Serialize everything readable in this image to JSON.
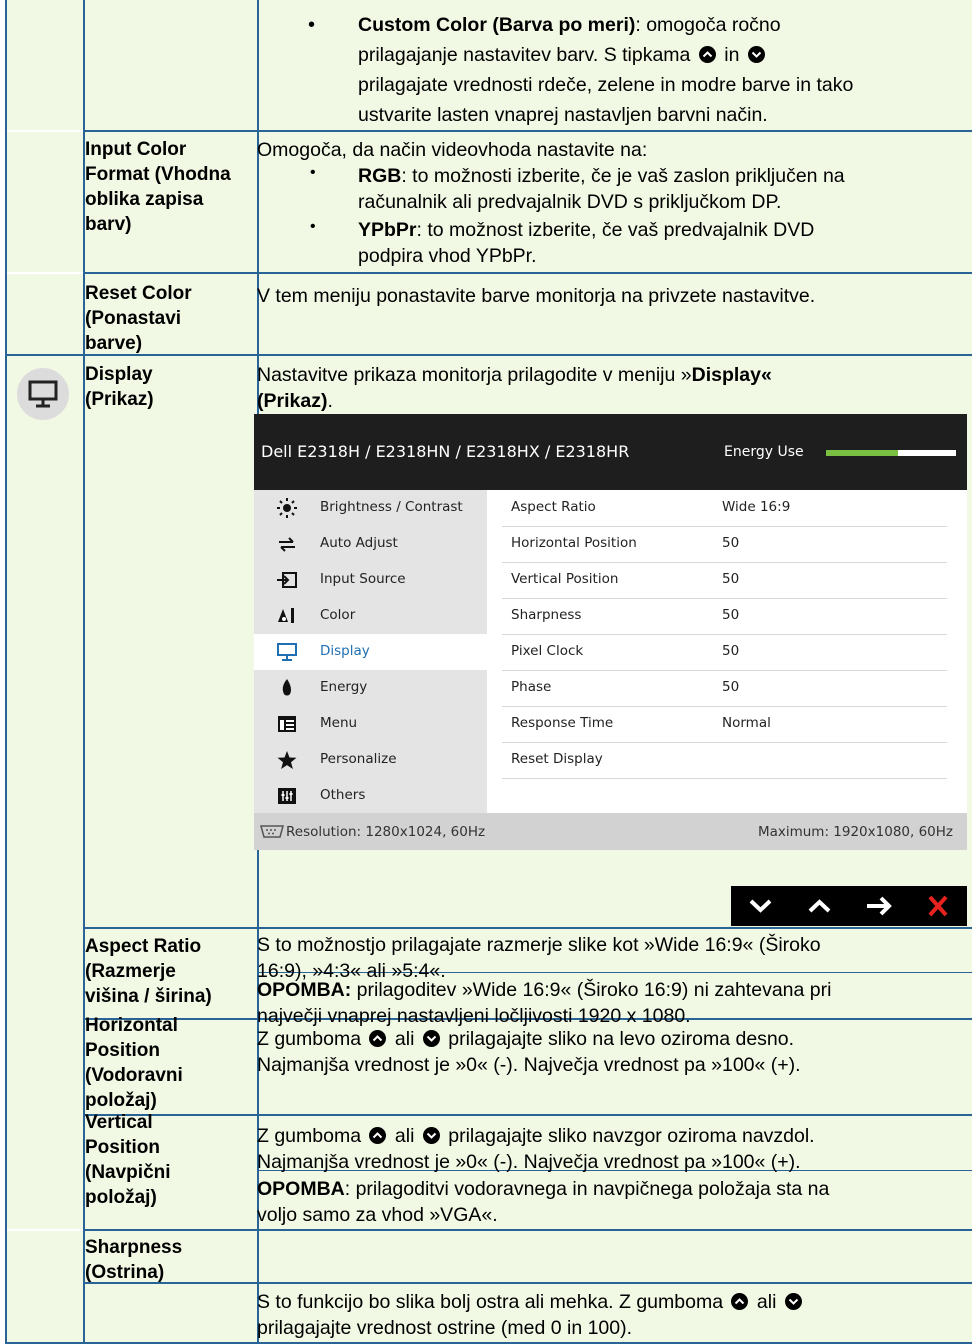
{
  "colors": {
    "border": "#2a6496",
    "row_bg": "#f1f8e4",
    "osd_accent": "#1f6fb2",
    "energy_green": "#7ac143",
    "close_red": "#e8231f"
  },
  "row1": {
    "bullet": "•",
    "bold": "Custom Color (Barva po meri)",
    "text_a": ": omogoča ročno",
    "line2_a": "prilagajanje nastavitev barv. S tipkama",
    "line2_b": "in",
    "line3": "prilagajate vrednosti rdeče, zelene in modre barve in tako",
    "line4": "ustvarite lasten vnaprej nastavljen barvni način."
  },
  "row2": {
    "label": [
      "Input Color",
      "Format (Vhodna",
      "oblika zapisa",
      "barv)"
    ],
    "intro": "Omogoča, da način videovhoda nastavite na:",
    "b1_bold": "RGB",
    "b1_l1": ": to možnosti izberite, če je vaš zaslon priključen na",
    "b1_l2": "računalnik ali predvajalnik DVD s priključkom DP.",
    "b2_bold": "YPbPr",
    "b2_l1": ": to možnost izberite, če vaš predvajalnik DVD",
    "b2_l2": "podpira vhod YPbPr.",
    "bullet": "•"
  },
  "row3": {
    "label": [
      "Reset Color",
      "(Ponastavi",
      "barve)"
    ],
    "text": "V tem meniju ponastavite barve monitorja na privzete nastavitve."
  },
  "row4": {
    "icon": "display-icon",
    "label": [
      "Display",
      "(Prikaz)"
    ],
    "text_a": "Nastavitve prikaza monitorja prilagodite v meniju »",
    "text_b": "Display«",
    "text_c": "(Prikaz)",
    "text_d": "."
  },
  "osd": {
    "title": "Dell E2318H / E2318HN / E2318HX / E2318HR",
    "energy_label": "Energy Use",
    "energy_level": 0.55,
    "menu": [
      {
        "label": "Brightness / Contrast",
        "icon": "brightness-icon",
        "selected": false
      },
      {
        "label": "Auto Adjust",
        "icon": "auto-adjust-icon",
        "selected": false
      },
      {
        "label": "Input Source",
        "icon": "input-source-icon",
        "selected": false
      },
      {
        "label": "Color",
        "icon": "color-icon",
        "selected": false
      },
      {
        "label": "Display",
        "icon": "display-icon",
        "selected": true
      },
      {
        "label": "Energy",
        "icon": "energy-icon",
        "selected": false
      },
      {
        "label": "Menu",
        "icon": "menu-icon",
        "selected": false
      },
      {
        "label": "Personalize",
        "icon": "star-icon",
        "selected": false
      },
      {
        "label": "Others",
        "icon": "others-icon",
        "selected": false
      }
    ],
    "params": [
      {
        "name": "Aspect Ratio",
        "value": "Wide 16:9"
      },
      {
        "name": "Horizontal Position",
        "value": "50"
      },
      {
        "name": "Vertical Position",
        "value": "50"
      },
      {
        "name": "Sharpness",
        "value": "50"
      },
      {
        "name": "Pixel Clock",
        "value": "50"
      },
      {
        "name": "Phase",
        "value": "50"
      },
      {
        "name": "Response Time",
        "value": "Normal"
      },
      {
        "name": "Reset Display",
        "value": ""
      }
    ],
    "resolution": "Resolution: 1280x1024, 60Hz",
    "maximum": "Maximum: 1920x1080, 60Hz",
    "nav_buttons": [
      "down-icon",
      "up-icon",
      "right-arrow-icon",
      "close-icon"
    ]
  },
  "row5": {
    "label": [
      "Aspect Ratio",
      "(Razmerje",
      "višina / širina)"
    ],
    "l1": "S to možnostjo prilagajate razmerje slike kot »Wide 16:9« (Široko",
    "l2": "16:9), »4:3« ali »5:4«.",
    "note_bold": "OPOMBA:",
    "note_l1": " prilagoditev »Wide 16:9« (Široko 16:9) ni zahtevana pri",
    "note_l2": "največji vnaprej nastavljeni ločljivosti 1920 x 1080."
  },
  "row6": {
    "label": [
      "Horizontal",
      "Position",
      "(Vodoravni",
      "položaj)"
    ],
    "l1a": "Z gumboma",
    "l1b": "ali",
    "l1c": "prilagajajte sliko na levo oziroma desno.",
    "l2": "Najmanjša vrednost je »0« (-). Največja vrednost pa »100« (+)."
  },
  "row7": {
    "label": [
      "Vertical",
      "Position",
      "(Navpični",
      "položaj)"
    ],
    "l1a": " Z gumboma",
    "l1b": "ali",
    "l1c": "prilagajajte sliko navzgor oziroma navzdol.",
    "l2": "Najmanjša vrednost je »0« (-). Največja vrednost pa »100« (+).",
    "note_bold": "OPOMBA",
    "note_l1": ": prilagoditvi vodoravnega in navpičnega položaja sta na",
    "note_l2": "voljo samo za vhod »VGA«."
  },
  "row8": {
    "label": [
      "Sharpness",
      "(Ostrina)"
    ],
    "l1a": "S to funkcijo bo slika bolj ostra ali mehka. Z gumboma",
    "l1b": "ali",
    "l2": "prilagajajte vrednost ostrine (med 0 in 100)."
  }
}
